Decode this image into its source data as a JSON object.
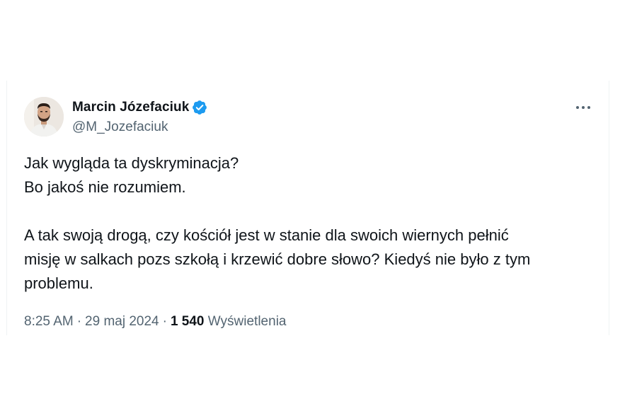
{
  "author": {
    "display_name": "Marcin Józefaciuk",
    "handle": "@M_Jozefaciuk",
    "verified": true,
    "verified_color": "#1d9bf0"
  },
  "tweet": {
    "lines": [
      "Jak wygląda ta dyskryminacja?",
      "Bo jakoś nie rozumiem.",
      "",
      "A tak swoją drogą, czy kościół jest w stanie dla swoich wiernych pełnić",
      "misję w salkach pozs szkołą i krzewić dobre słowo? Kiedyś nie było z tym",
      "problemu."
    ]
  },
  "meta": {
    "time": "8:25 AM",
    "separator": "·",
    "date": "29 maj 2024",
    "views_count": "1 540",
    "views_label": "Wyświetlenia"
  },
  "icons": {
    "more": "more-horizontal-icon",
    "verified": "verified-badge-icon"
  },
  "colors": {
    "text_primary": "#0f1419",
    "text_secondary": "#536471",
    "border": "#eff3f4"
  }
}
